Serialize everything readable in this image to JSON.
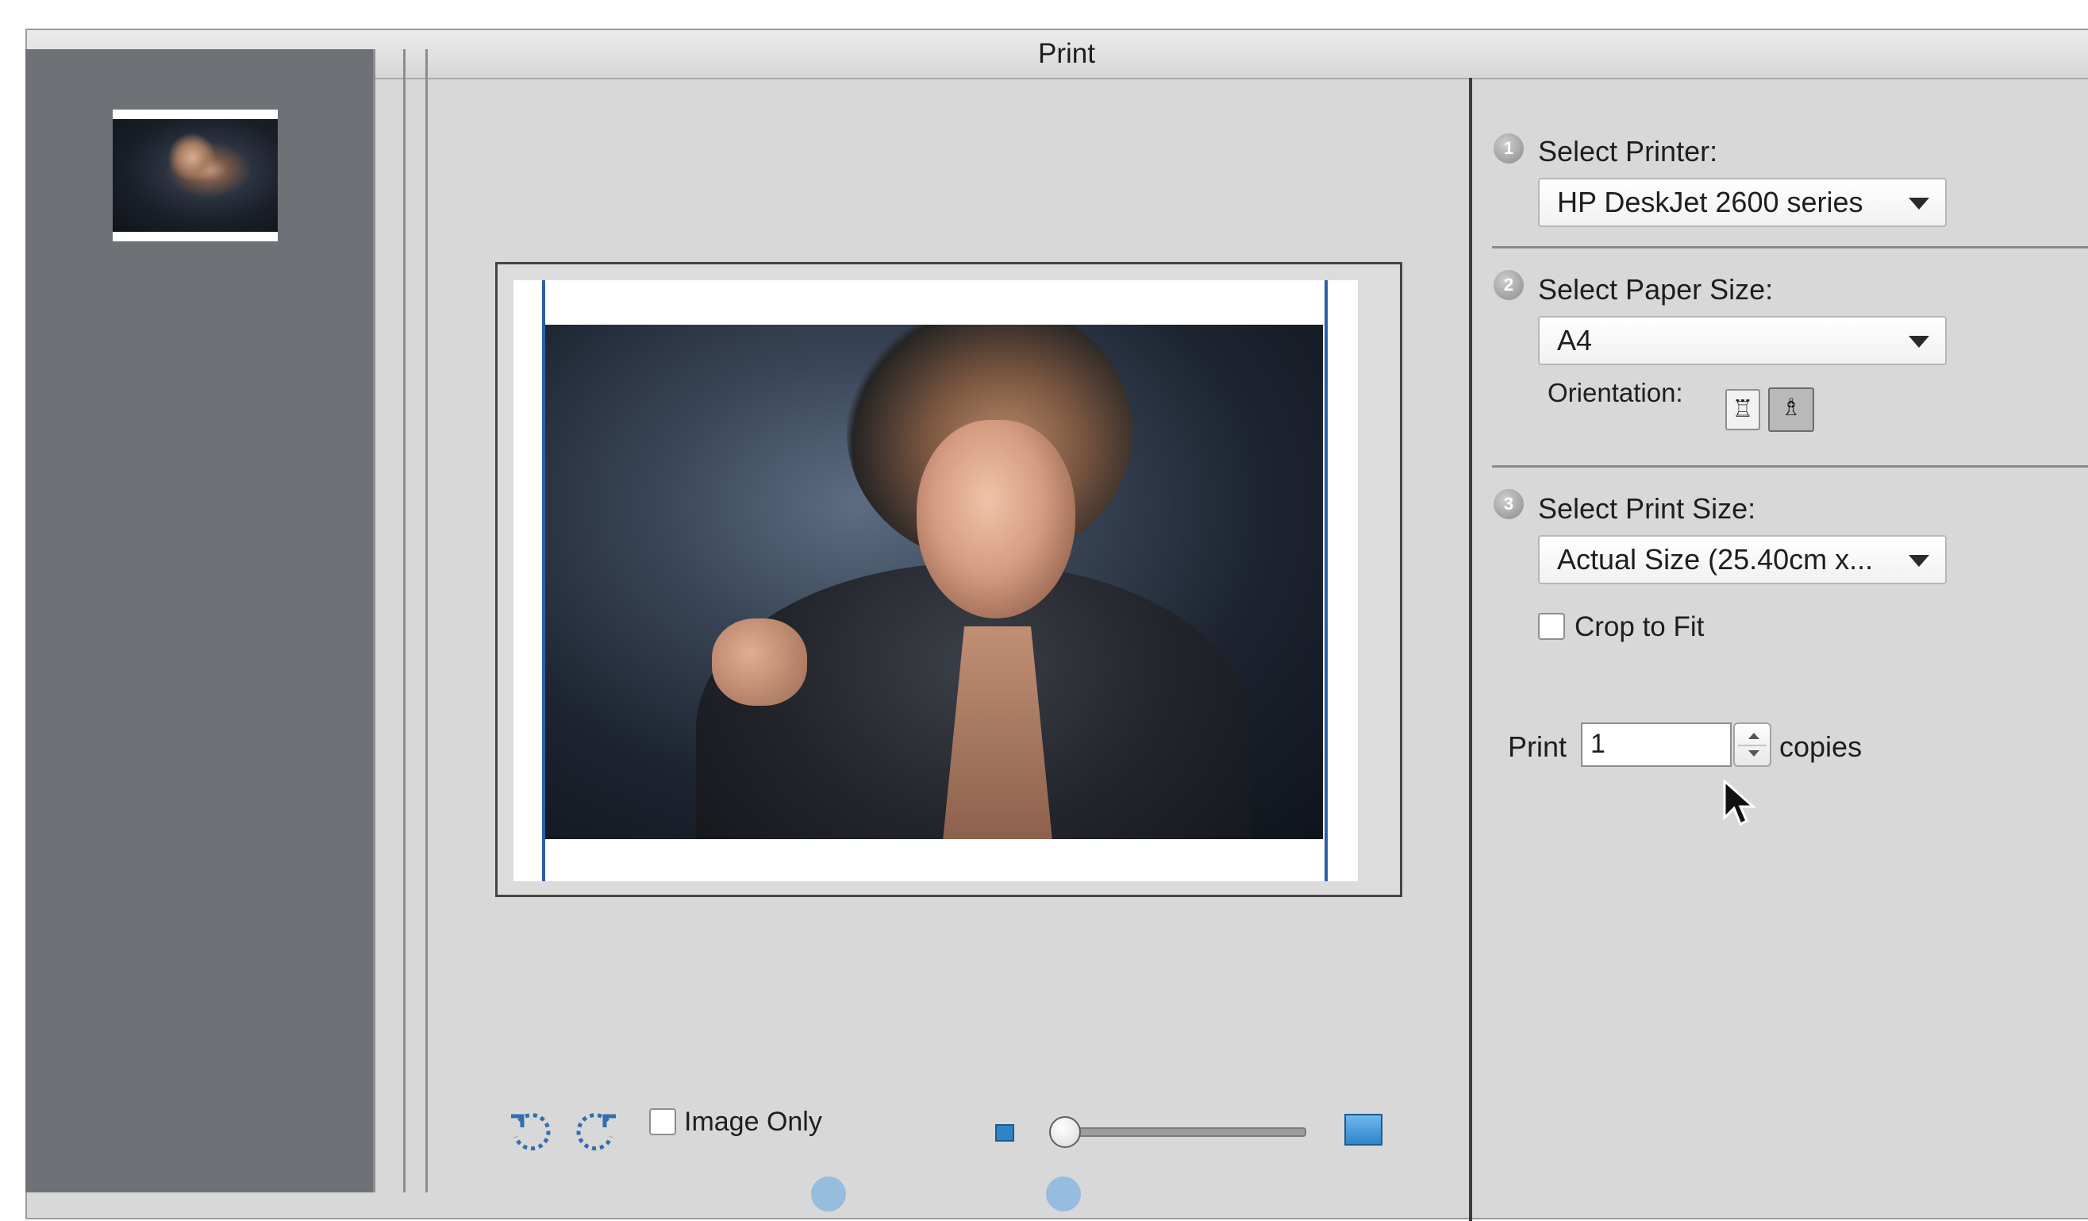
{
  "window": {
    "title": "Print"
  },
  "printer": {
    "step": "1",
    "label": "Select Printer:",
    "selected": "HP DeskJet 2600 series"
  },
  "paper": {
    "step": "2",
    "label": "Select Paper Size:",
    "selected": "A4",
    "orientation_label": "Orientation:",
    "orientation_selected": "landscape"
  },
  "print_size": {
    "step": "3",
    "label": "Select Print Size:",
    "selected": "Actual Size (25.40cm x...",
    "crop_label": "Crop to Fit",
    "crop_checked": false
  },
  "copies": {
    "prefix": "Print",
    "value": "1",
    "suffix": "copies"
  },
  "preview_tools": {
    "image_only_label": "Image Only",
    "image_only_checked": false,
    "zoom_level": 0.0
  },
  "colors": {
    "margin_line": "#2d5fa5",
    "zoom_icon": "#2f84c8",
    "sidebar": "#6e7276"
  },
  "icons": [
    "rotate-left-icon",
    "rotate-right-icon",
    "zoom-out-icon",
    "zoom-in-icon",
    "portrait-orientation-icon",
    "landscape-orientation-icon",
    "mouse-cursor-icon"
  ]
}
